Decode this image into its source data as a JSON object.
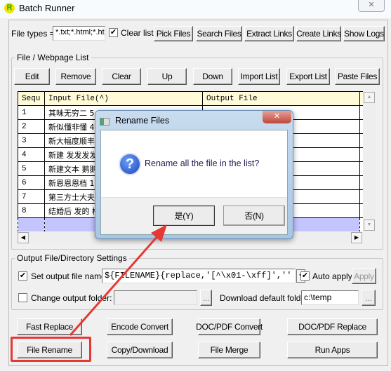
{
  "window": {
    "title": "Batch Runner",
    "close": "✕"
  },
  "toolbar": {
    "file_types_label": "File types =>",
    "file_types_value": "*.txt;*.html;*.ht",
    "clear_list_label": "Clear list",
    "clear_list_checked": true,
    "buttons": [
      "Pick Files",
      "Search Files",
      "Extract Links",
      "Create Links",
      "Show Logs"
    ]
  },
  "list": {
    "group_label": "File / Webpage List",
    "buttons": [
      "Edit",
      "Remove",
      "Clear",
      "Up",
      "Down",
      "Import List",
      "Export List",
      "Paste Files"
    ],
    "columns": [
      "Sequ",
      "Input File(^)",
      "Output File"
    ],
    "rows": [
      {
        "seq": "1",
        "input": "其味无穷二 5"
      },
      {
        "seq": "2",
        "input": "新似懂非懂 4"
      },
      {
        "seq": "3",
        "input": "新大幅度顺丰"
      },
      {
        "seq": "4",
        "input": "新建 发发发发"
      },
      {
        "seq": "5",
        "input": "新建文本 鹅鹅"
      },
      {
        "seq": "6",
        "input": "新恩恩恩档 1"
      },
      {
        "seq": "7",
        "input": "第三方士大夫"
      },
      {
        "seq": "8",
        "input": "结婚后 发的 样"
      }
    ]
  },
  "output": {
    "group_label": "Output File/Directory Settings",
    "set_name_label": "Set output file name:",
    "set_name_checked": true,
    "name_value": "${FILENAME}{replace,'[^\\x01-\\xff]',''",
    "auto_apply_label": "Auto apply",
    "auto_apply_checked": true,
    "apply": "Apply",
    "change_folder_label": "Change output folder:",
    "change_folder_checked": false,
    "browse": "...",
    "download_label": "Download default folder:",
    "download_value": "c:\\temp"
  },
  "actions": {
    "row1": [
      "Fast Replace",
      "Encode Convert",
      "DOC/PDF Convert",
      "DOC/PDF Replace"
    ],
    "row2": [
      "File Rename",
      "Copy/Download",
      "File Merge",
      "Run Apps"
    ]
  },
  "dialog": {
    "title": "Rename Files",
    "message": "Rename all the file in the list?",
    "yes": "是(Y)",
    "no": "否(N)",
    "icon": "question-icon"
  },
  "colors": {
    "highlight": "#e53935",
    "selection": "#c4c4ff",
    "header": "#fffbd8"
  }
}
